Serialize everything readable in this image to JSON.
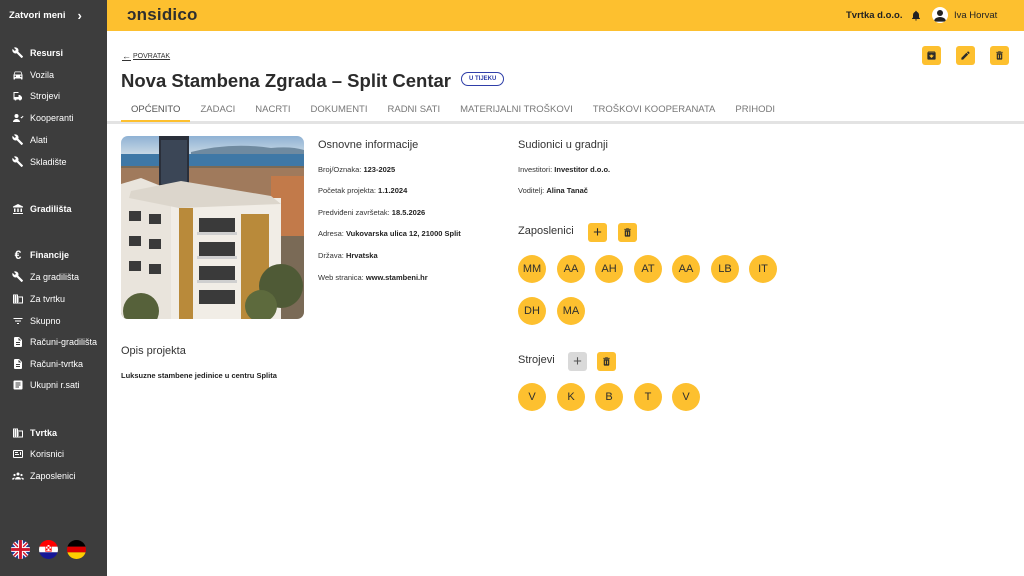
{
  "sidebar": {
    "toggle_label": "Zatvori meni",
    "items": [
      {
        "label": "Resursi",
        "icon": "tools-icon",
        "head": true
      },
      {
        "label": "Vozila",
        "icon": "car-icon"
      },
      {
        "label": "Strojevi",
        "icon": "machine-icon"
      },
      {
        "label": "Kooperanti",
        "icon": "handshake-icon"
      },
      {
        "label": "Alati",
        "icon": "tools-icon"
      },
      {
        "label": "Skladište",
        "icon": "tools-icon"
      },
      {
        "label": "Gradilišta",
        "icon": "bank-icon",
        "head": true
      },
      {
        "label": "Financije",
        "icon": "euro-icon",
        "head": true
      },
      {
        "label": "Za gradilišta",
        "icon": "tools-icon"
      },
      {
        "label": "Za tvrtku",
        "icon": "building-icon"
      },
      {
        "label": "Skupno",
        "icon": "filter-icon"
      },
      {
        "label": "Računi-gradilišta",
        "icon": "document-icon"
      },
      {
        "label": "Računi-tvrtka",
        "icon": "document-icon"
      },
      {
        "label": "Ukupni r.sati",
        "icon": "list-icon"
      },
      {
        "label": "Tvrtka",
        "icon": "building-icon",
        "head": true
      },
      {
        "label": "Korisnici",
        "icon": "id-card-icon"
      },
      {
        "label": "Zaposlenici",
        "icon": "people-icon"
      }
    ]
  },
  "topbar": {
    "logo": "ɔnsidico",
    "company": "Tvrtka d.o.o.",
    "user": "Iva Horvat"
  },
  "header": {
    "back_label": "POVRATAK",
    "title": "Nova Stambena Zgrada – Split Centar",
    "status": "U TIJEKU"
  },
  "tabs": [
    "OPĆENITO",
    "ZADACI",
    "NACRTI",
    "DOKUMENTI",
    "RADNI SATI",
    "MATERIJALNI TROŠKOVI",
    "TROŠKOVI KOOPERANATA",
    "PRIHODI"
  ],
  "info": {
    "title": "Osnovne informacije",
    "rows": [
      {
        "label": "Broj/Oznaka:",
        "value": "123-2025"
      },
      {
        "label": "Početak projekta:",
        "value": "1.1.2024"
      },
      {
        "label": "Predviđeni završetak:",
        "value": "18.5.2026"
      },
      {
        "label": "Adresa:",
        "value": "Vukovarska ulica 12, 21000 Split"
      },
      {
        "label": "Država:",
        "value": "Hrvatska"
      },
      {
        "label": "Web stranica:",
        "value": "www.stambeni.hr"
      }
    ]
  },
  "description": {
    "title": "Opis projekta",
    "text": "Luksuzne stambene jedinice u centru Splita"
  },
  "participants": {
    "title": "Sudionici u gradnji",
    "investors_label": "Investitori:",
    "investors_value": "Investitor d.o.o.",
    "lead_label": "Voditelj:",
    "lead_value": "Alina Tanač"
  },
  "employees": {
    "title": "Zaposlenici",
    "initials": [
      "MM",
      "AA",
      "AH",
      "AT",
      "AA",
      "LB",
      "IT",
      "DH",
      "MA"
    ]
  },
  "machines": {
    "title": "Strojevi",
    "initials": [
      "V",
      "K",
      "B",
      "T",
      "V"
    ]
  },
  "colors": {
    "accent": "#fdc02f",
    "sidebar": "#3d3d3d",
    "status": "#2f3ea8"
  }
}
